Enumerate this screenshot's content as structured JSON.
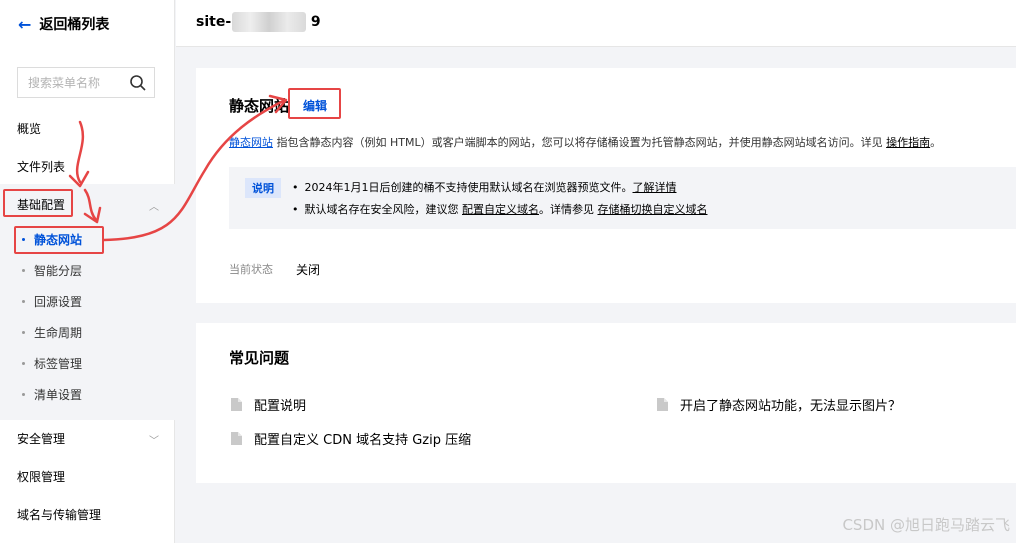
{
  "sidebar": {
    "back_label": "返回桶列表",
    "search_placeholder": "搜索菜单名称",
    "items": [
      {
        "label": "概览"
      },
      {
        "label": "文件列表"
      },
      {
        "label": "基础配置"
      },
      {
        "label": "安全管理"
      },
      {
        "label": "权限管理"
      },
      {
        "label": "域名与传输管理"
      }
    ],
    "sub_items": [
      {
        "label": "静态网站"
      },
      {
        "label": "智能分层"
      },
      {
        "label": "回源设置"
      },
      {
        "label": "生命周期"
      },
      {
        "label": "标签管理"
      },
      {
        "label": "清单设置"
      }
    ]
  },
  "header": {
    "bucket_name": "site-1",
    "bucket_suffix": "9"
  },
  "static_site": {
    "title": "静态网站",
    "edit_label": "编辑",
    "desc_link": "静态网站",
    "desc_text": " 指包含静态内容（例如 HTML）或客户端脚本的网站，您可以将存储桶设置为托管静态网站，并使用静态网站域名访问。详见 ",
    "desc_guide": "操作指南",
    "desc_end": "。",
    "notice_tag": "说明",
    "notice1_text": "2024年1月1日后创建的桶不支持使用默认域名在浏览器预览文件。",
    "notice1_link": "了解详情",
    "notice2_text": "默认域名存在安全风险，建议您 ",
    "notice2_link1": "配置自定义域名",
    "notice2_mid": "。详情参见 ",
    "notice2_link2": "存储桶切换自定义域名",
    "state_label": "当前状态",
    "state_value": "关闭"
  },
  "faq": {
    "title": "常见问题",
    "items": [
      {
        "label": "配置说明"
      },
      {
        "label": "开启了静态网站功能，无法显示图片？"
      },
      {
        "label": "配置自定义 CDN 域名支持 Gzip 压缩"
      }
    ]
  },
  "watermark": "CSDN @旭日跑马踏云飞",
  "colors": {
    "accent": "#0052d9",
    "annotation": "#e64545"
  }
}
